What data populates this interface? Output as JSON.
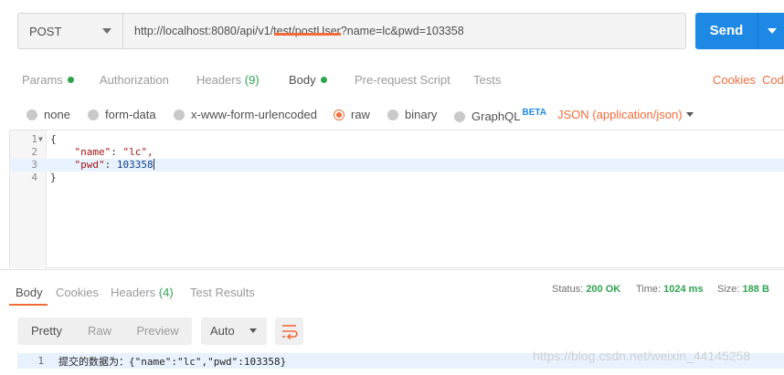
{
  "request": {
    "method": "POST",
    "url": "http://localhost:8080/api/v1/test/postUser?name=lc&pwd=103358",
    "send_label": "Send"
  },
  "request_tabs": {
    "params": "Params",
    "authorization": "Authorization",
    "headers": "Headers",
    "headers_count": "(9)",
    "body": "Body",
    "pre_request": "Pre-request Script",
    "tests": "Tests",
    "cookies": "Cookies",
    "code": "Code"
  },
  "body_types": {
    "none": "none",
    "form_data": "form-data",
    "urlencoded": "x-www-form-urlencoded",
    "raw": "raw",
    "binary": "binary",
    "graphql": "GraphQL",
    "beta": "BETA",
    "content_type": "JSON (application/json)",
    "selected": "raw"
  },
  "editor": {
    "lines": [
      {
        "num": "1",
        "text": "{"
      },
      {
        "num": "2",
        "key": "\"name\"",
        "value": "\"lc\","
      },
      {
        "num": "3",
        "key": "\"pwd\"",
        "value": "103358"
      },
      {
        "num": "4",
        "text": "}"
      }
    ]
  },
  "response_tabs": {
    "body": "Body",
    "cookies": "Cookies",
    "headers": "Headers",
    "headers_count": "(4)",
    "test_results": "Test Results"
  },
  "response_status": {
    "status_label": "Status:",
    "status_value": "200 OK",
    "time_label": "Time:",
    "time_value": "1024 ms",
    "size_label": "Size:",
    "size_value": "188 B"
  },
  "response_toolbar": {
    "pretty": "Pretty",
    "raw": "Raw",
    "preview": "Preview",
    "format": "Auto"
  },
  "response_body": {
    "line_num": "1",
    "text": "提交的数据为：{\"name\":\"lc\",\"pwd\":103358}"
  },
  "watermark": "https://blog.csdn.net/weixin_44145258",
  "colors": {
    "accent": "#f26b3a",
    "send": "#1e88e5",
    "success": "#2ea44f"
  }
}
